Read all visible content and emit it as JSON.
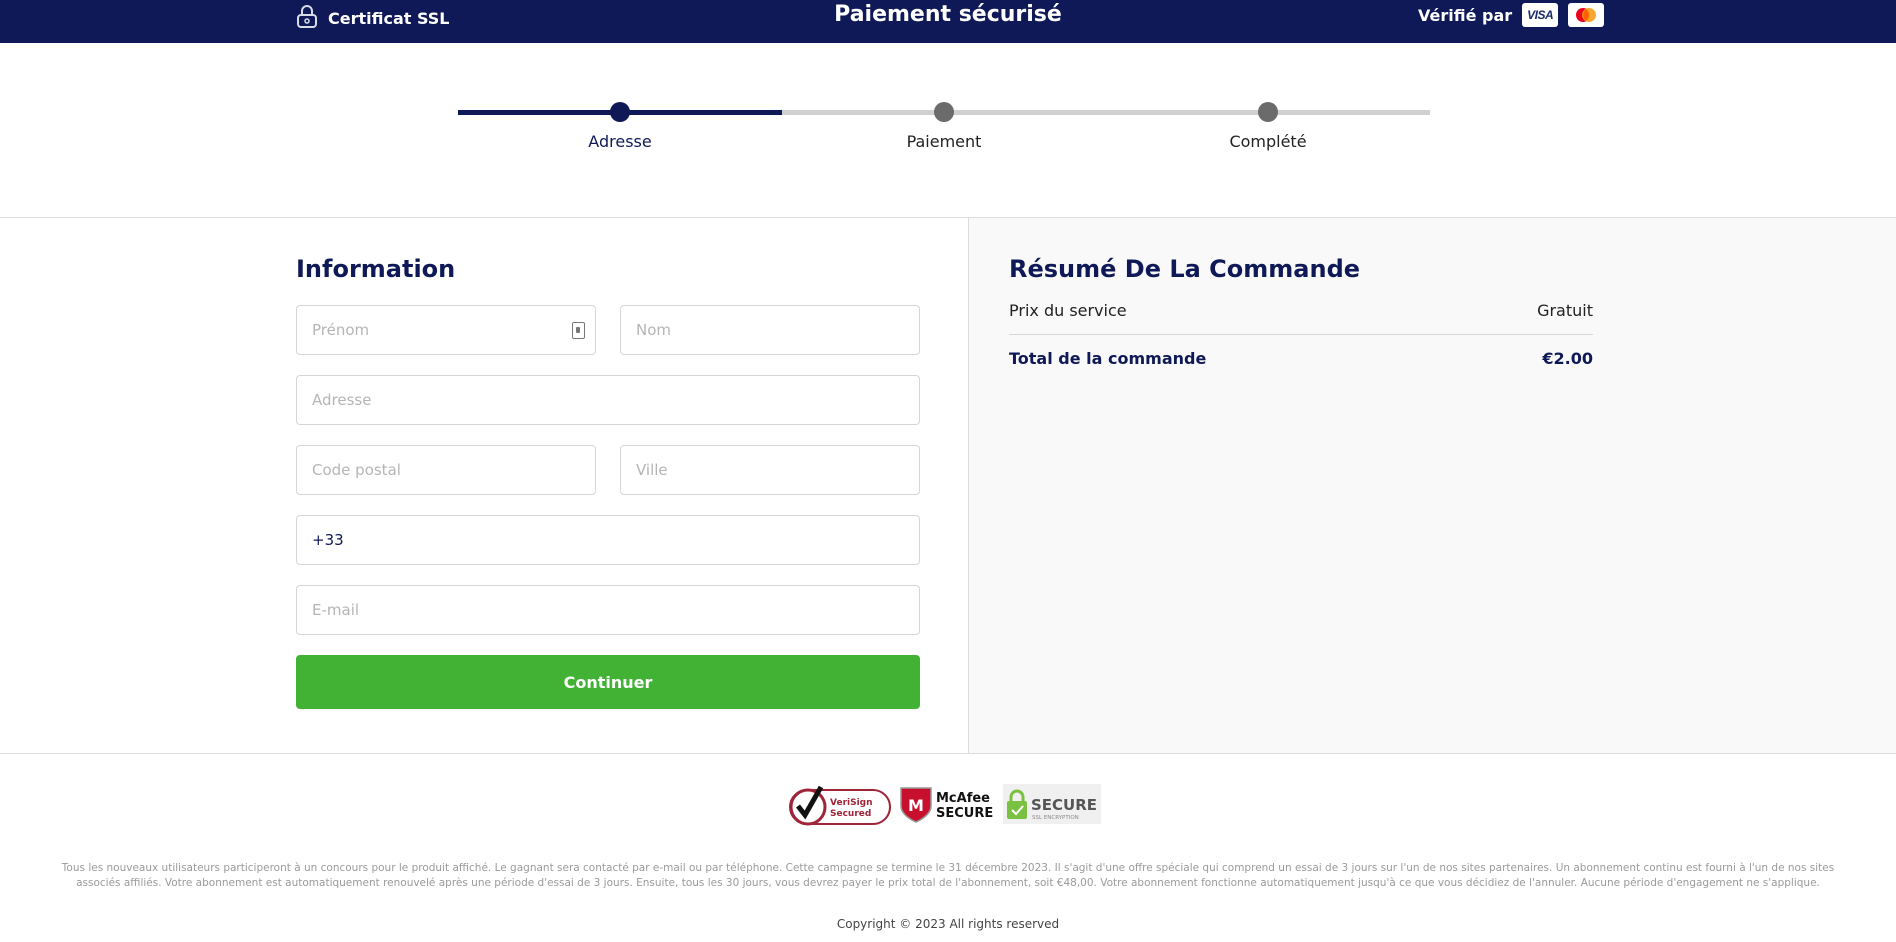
{
  "header": {
    "ssl_label": "Certificat SSL",
    "title": "Paiement sécurisé",
    "verified_label": "Vérifié par",
    "cards": [
      "VISA",
      "mastercard"
    ],
    "background_color": "#0f1957"
  },
  "stepper": {
    "progress": 0.333,
    "steps": [
      {
        "label": "Adresse",
        "active": true
      },
      {
        "label": "Paiement",
        "active": false
      },
      {
        "label": "Complété",
        "active": false
      }
    ]
  },
  "form": {
    "heading": "Information",
    "fields": {
      "first_name": {
        "placeholder": "Prénom",
        "value": ""
      },
      "last_name": {
        "placeholder": "Nom",
        "value": ""
      },
      "address": {
        "placeholder": "Adresse",
        "value": ""
      },
      "postal_code": {
        "placeholder": "Code postal",
        "value": ""
      },
      "city": {
        "placeholder": "Ville",
        "value": ""
      },
      "phone": {
        "placeholder": "",
        "value": "+33"
      },
      "email": {
        "placeholder": "E-mail",
        "value": ""
      }
    },
    "submit_label": "Continuer",
    "submit_color": "#41b233"
  },
  "summary": {
    "heading": "Résumé De La Commande",
    "rows": [
      {
        "label": "Prix du service",
        "value": "Gratuit"
      },
      {
        "label": "Total de la commande",
        "value": "€2.00"
      }
    ]
  },
  "footer": {
    "badges": [
      {
        "name": "VeriSign",
        "line1": "VeriSign",
        "line2": "Secured"
      },
      {
        "name": "McAfee",
        "line1": "McAfee",
        "line2": "SECURE"
      },
      {
        "name": "SSL",
        "line1": "SECURE",
        "line2": "SSL ENCRYPTION"
      }
    ],
    "disclaimer": "Tous les nouveaux utilisateurs participeront à un concours pour le produit affiché. Le gagnant sera contacté par e-mail ou par téléphone. Cette campagne se termine le 31 décembre 2023. Il s'agit d'une offre spéciale qui comprend un essai de 3 jours sur l'un de nos sites partenaires. Un abonnement continu est fourni à l'un de nos sites associés affiliés. Votre abonnement est automatiquement renouvelé après une période d'essai de 3 jours. Ensuite, tous les 30 jours, vous devrez payer le prix total de l'abonnement, soit €48,00. Votre abonnement fonctionne automatiquement jusqu'à ce que vous décidiez de l'annuler. Aucune période d'engagement ne s'applique.",
    "copyright": "Copyright © 2023 All rights reserved"
  }
}
